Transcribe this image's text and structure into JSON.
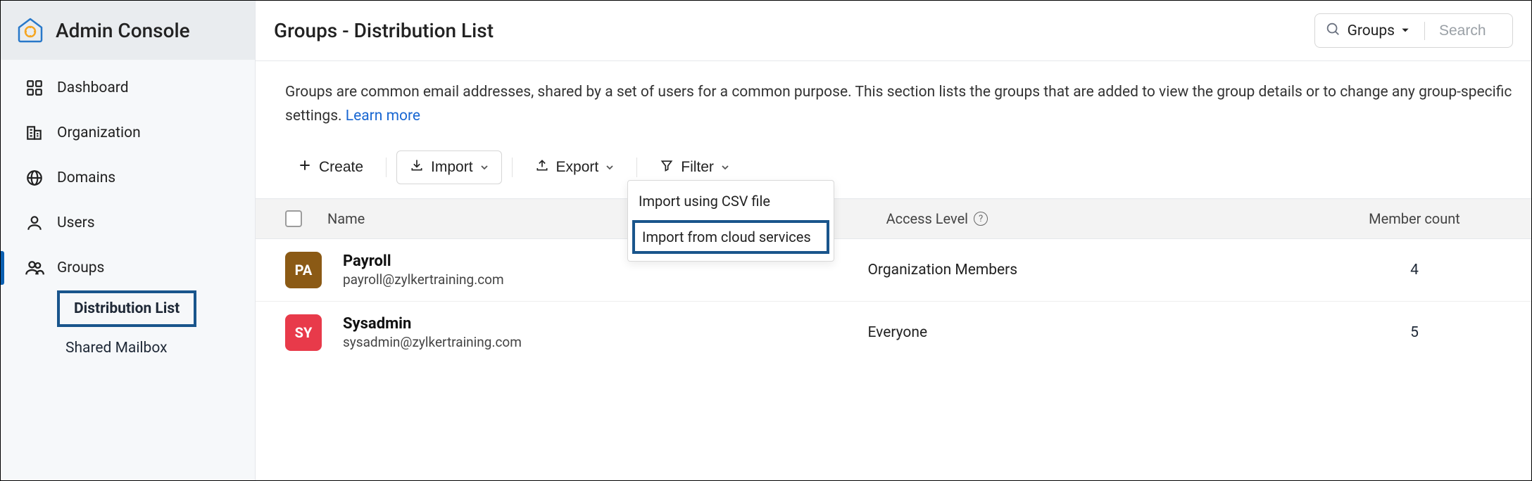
{
  "header": {
    "title": "Admin Console"
  },
  "sidebar": {
    "items": [
      {
        "icon": "dashboard-icon",
        "label": "Dashboard"
      },
      {
        "icon": "organization-icon",
        "label": "Organization"
      },
      {
        "icon": "domains-icon",
        "label": "Domains"
      },
      {
        "icon": "users-icon",
        "label": "Users"
      },
      {
        "icon": "groups-icon",
        "label": "Groups",
        "active": true
      }
    ],
    "subitems": [
      {
        "label": "Distribution List",
        "highlight": true
      },
      {
        "label": "Shared Mailbox",
        "highlight": false
      }
    ]
  },
  "page": {
    "title": "Groups - Distribution List",
    "description_pre": "Groups are common email addresses, shared by a set of users for a common purpose. This section lists the groups that are added to view the group details or to change any group-specific settings.  ",
    "learn_more": "Learn more"
  },
  "search": {
    "scope": "Groups",
    "placeholder": "Search"
  },
  "toolbar": {
    "create": "Create",
    "import": "Import",
    "export": "Export",
    "filter": "Filter"
  },
  "import_menu": {
    "csv": "Import using CSV file",
    "cloud": "Import from cloud services"
  },
  "table": {
    "columns": {
      "name": "Name",
      "access": "Access Level",
      "members": "Member count"
    },
    "rows": [
      {
        "avatar_initials": "PA",
        "avatar_color": "#8b5a15",
        "name": "Payroll",
        "email": "payroll@zylkertraining.com",
        "access": "Organization Members",
        "members": "4"
      },
      {
        "avatar_initials": "SY",
        "avatar_color": "#e83a4a",
        "name": "Sysadmin",
        "email": "sysadmin@zylkertraining.com",
        "access": "Everyone",
        "members": "5"
      }
    ]
  }
}
